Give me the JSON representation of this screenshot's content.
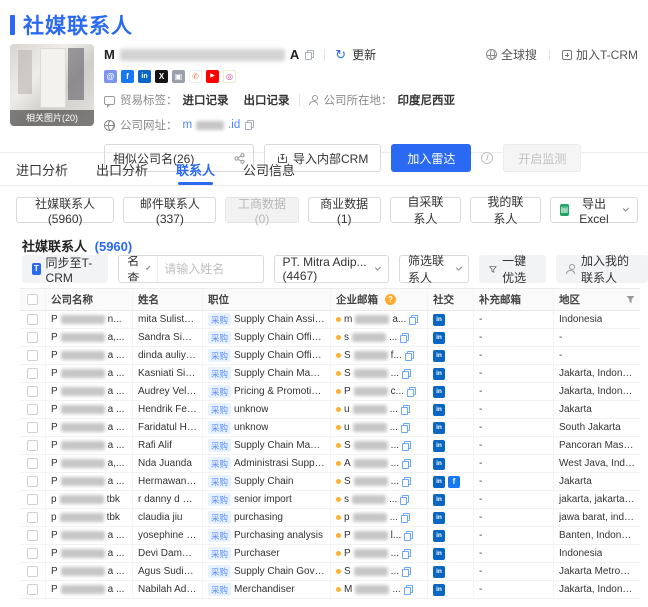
{
  "page": {
    "title": "社媒联系人"
  },
  "header": {
    "company_name_prefix": "M",
    "company_name_suffix": "A",
    "refresh_label": "更新",
    "photo_label": "相关图片(20)",
    "global_search_label": "全球搜",
    "join_tcrm_label": "加入T-CRM",
    "trade_label": "贸易标签：",
    "trade_tags": [
      "进口记录",
      "出口记录"
    ],
    "location_label": "公司所在地：",
    "location_value": "印度尼西亚",
    "website_label": "公司网址：",
    "website_prefix": "m",
    "website_suffix": ".id",
    "social_icons": [
      {
        "name": "blog",
        "glyph": "@",
        "bg": "#7c95ef",
        "fg": "#ffffff",
        "border": "none"
      },
      {
        "name": "facebook",
        "glyph": "f",
        "bg": "#1877f2",
        "fg": "#ffffff",
        "border": "none"
      },
      {
        "name": "linkedin",
        "glyph": "in",
        "bg": "#0a66c2",
        "fg": "#ffffff",
        "border": "none"
      },
      {
        "name": "x-twitter",
        "glyph": "X",
        "bg": "#141414",
        "fg": "#ffffff",
        "border": "none"
      },
      {
        "name": "brand-gray",
        "glyph": "▣",
        "bg": "#9aa0ab",
        "fg": "#ffffff",
        "border": "none"
      },
      {
        "name": "phone",
        "glyph": "✆",
        "bg": "#ffffff",
        "fg": "#ff7a45",
        "border": "1px solid #eee"
      },
      {
        "name": "youtube",
        "glyph": "▶",
        "bg": "#ff0000",
        "fg": "#ffffff",
        "border": "none"
      },
      {
        "name": "instagram",
        "glyph": "◎",
        "bg": "#ffffff",
        "fg": "#d6409f",
        "border": "1px solid #eec"
      }
    ],
    "actions": {
      "similar_companies": "相似公司名(26)",
      "import_crm": "导入内部CRM",
      "add_radar": "加入雷达",
      "enable_monitor": "开启监测"
    }
  },
  "tabs": [
    {
      "label": "进口分析",
      "active": false
    },
    {
      "label": "出口分析",
      "active": false
    },
    {
      "label": "联系人",
      "active": true
    },
    {
      "label": "公司信息",
      "active": false
    }
  ],
  "contact_sources": [
    {
      "label": "社媒联系人(5960)",
      "disabled": false
    },
    {
      "label": "邮件联系人(337)",
      "disabled": false
    },
    {
      "label": "工商数据(0)",
      "disabled": true
    },
    {
      "label": "商业数据(1)",
      "disabled": false
    },
    {
      "label": "自采联系人",
      "disabled": false
    },
    {
      "label": "我的联系人",
      "disabled": false
    }
  ],
  "export_label": "导出 Excel",
  "section": {
    "title": "社媒联系人",
    "count": "(5960)"
  },
  "toolbar": {
    "sync_tcrm": "同步至T-CRM",
    "name_query": "姓名查询",
    "name_placeholder": "请输入姓名",
    "company_filter": "PT. Mitra Adip... (4467)",
    "filter_contacts": "筛选联系人",
    "quick_select": "一键优选",
    "add_to_my": "加入我的联系人"
  },
  "table": {
    "headers": [
      "公司名称",
      "姓名",
      "职位",
      "企业邮箱",
      "社交",
      "补充邮箱",
      "地区"
    ],
    "tag_label": "采购",
    "rows": [
      {
        "company_prefix": "P",
        "company_suffix": "n...",
        "name": "mita Sulistyandari",
        "title": "Supply Chain Assistant Man...",
        "email_prefix": "m",
        "email_suffix": "a...",
        "socials": [
          "in"
        ],
        "extra_email": "-",
        "region": "Indonesia"
      },
      {
        "company_prefix": "P",
        "company_suffix": "a,...",
        "name": "Sandra Sianipar",
        "title": "Supply Chain Officer",
        "email_prefix": "s",
        "email_suffix": "...",
        "socials": [
          "in"
        ],
        "extra_email": "-",
        "region": "-"
      },
      {
        "company_prefix": "P",
        "company_suffix": "a ...",
        "name": "dinda auliya adha",
        "title": "Supply Chain Officer",
        "email_prefix": "S",
        "email_suffix": "f...",
        "socials": [
          "in"
        ],
        "extra_email": "-",
        "region": "-"
      },
      {
        "company_prefix": "P",
        "company_suffix": "a ...",
        "name": "Kasniati Sinaga",
        "title": "Supply Chain Management",
        "email_prefix": "S",
        "email_suffix": "...",
        "socials": [
          "in"
        ],
        "extra_email": "-",
        "region": "Jakarta, Indonesia"
      },
      {
        "company_prefix": "P",
        "company_suffix": "a ...",
        "name": "Audrey Vellicia",
        "title": "Pricing & Promotion Execut...",
        "email_prefix": "P",
        "email_suffix": "c...",
        "socials": [
          "in"
        ],
        "extra_email": "-",
        "region": "Jakarta, Indonesia"
      },
      {
        "company_prefix": "P",
        "company_suffix": "a ...",
        "name": "Hendrik Fendi",
        "title": "unknow",
        "email_prefix": "u",
        "email_suffix": "...",
        "socials": [
          "in"
        ],
        "extra_email": "-",
        "region": "Jakarta"
      },
      {
        "company_prefix": "P",
        "company_suffix": "a ...",
        "name": "Faridatul Hidzroh",
        "title": "unknow",
        "email_prefix": "u",
        "email_suffix": "...",
        "socials": [
          "in"
        ],
        "extra_email": "-",
        "region": "South Jakarta"
      },
      {
        "company_prefix": "P",
        "company_suffix": "a ...",
        "name": "Rafi Alif",
        "title": "Supply Chain Management ...",
        "email_prefix": "S",
        "email_suffix": "...",
        "socials": [
          "in"
        ],
        "extra_email": "-",
        "region": "Pancoran Mas, ..."
      },
      {
        "company_prefix": "P",
        "company_suffix": "a,...",
        "name": "Nda Juanda",
        "title": "Administrasi Supply Chain (...",
        "email_prefix": "A",
        "email_suffix": "...",
        "socials": [
          "in"
        ],
        "extra_email": "-",
        "region": "West Java, Indo..."
      },
      {
        "company_prefix": "P",
        "company_suffix": "a ...",
        "name": "Hermawan Sapu...",
        "title": "Supply Chain",
        "email_prefix": "S",
        "email_suffix": "...",
        "socials": [
          "in",
          "fb"
        ],
        "extra_email": "-",
        "region": "Jakarta"
      },
      {
        "company_prefix": "p",
        "company_suffix": "tbk",
        "name": "r danny d nurpat...",
        "title": "senior import",
        "email_prefix": "s",
        "email_suffix": "...",
        "socials": [
          "in"
        ],
        "extra_email": "-",
        "region": "jakarta, jakarta r..."
      },
      {
        "company_prefix": "p",
        "company_suffix": "tbk",
        "name": "claudia jiu",
        "title": "purchasing",
        "email_prefix": "p",
        "email_suffix": "...",
        "socials": [
          "in"
        ],
        "extra_email": "-",
        "region": "jawa barat, indo..."
      },
      {
        "company_prefix": "P",
        "company_suffix": "a ...",
        "name": "yosephine liviane",
        "title": "Purchasing analysis",
        "email_prefix": "P",
        "email_suffix": "l...",
        "socials": [
          "in"
        ],
        "extra_email": "-",
        "region": "Banten, Indonesia"
      },
      {
        "company_prefix": "P",
        "company_suffix": "a ...",
        "name": "Devi Damayanti",
        "title": "Purchaser",
        "email_prefix": "P",
        "email_suffix": "...",
        "socials": [
          "in"
        ],
        "extra_email": "-",
        "region": "Indonesia"
      },
      {
        "company_prefix": "P",
        "company_suffix": "a ...",
        "name": "Agus Sudiharjo",
        "title": "Supply Chain Governance In...",
        "email_prefix": "S",
        "email_suffix": "...",
        "socials": [
          "in"
        ],
        "extra_email": "-",
        "region": "Jakarta Metropo..."
      },
      {
        "company_prefix": "P",
        "company_suffix": "a ...",
        "name": "Nabilah Adellia",
        "title": "Merchandiser",
        "email_prefix": "M",
        "email_suffix": "...",
        "socials": [
          "in"
        ],
        "extra_email": "-",
        "region": "Jakarta, Indonesia"
      }
    ]
  }
}
